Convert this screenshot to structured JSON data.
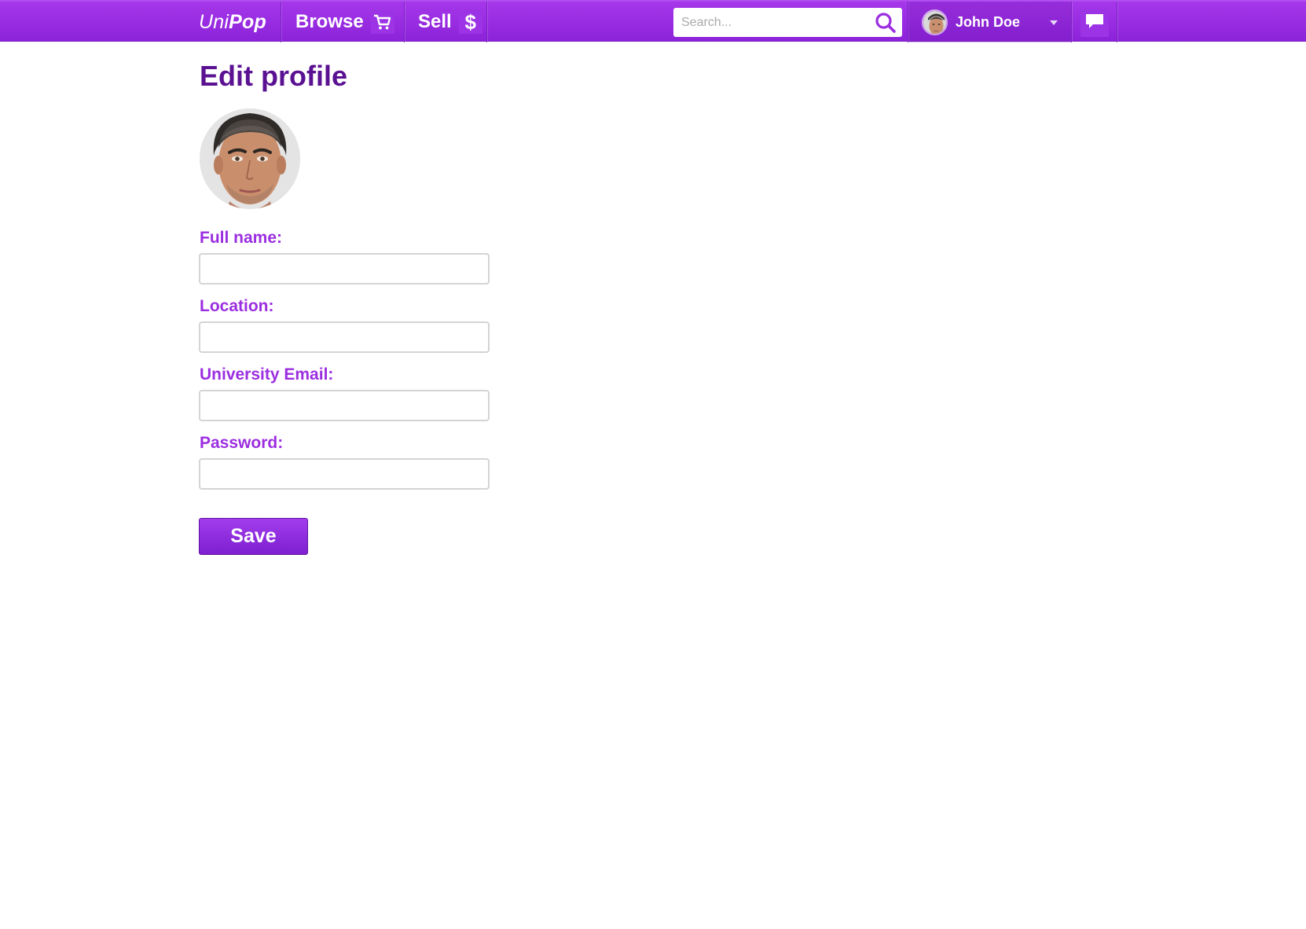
{
  "header": {
    "logo": {
      "part1": "Uni",
      "part2": "Pop"
    },
    "nav": {
      "browse_label": "Browse",
      "sell_label": "Sell",
      "sell_icon": "$"
    },
    "search": {
      "placeholder": "Search..."
    },
    "user": {
      "name": "John Doe"
    }
  },
  "main": {
    "title": "Edit profile",
    "form": {
      "full_name_label": "Full name:",
      "full_name_value": "",
      "location_label": "Location:",
      "location_value": "",
      "email_label": "University Email:",
      "email_value": "",
      "password_label": "Password:",
      "password_value": ""
    },
    "save_label": "Save"
  },
  "colors": {
    "brand_purple": "#9b2ee0",
    "title_purple": "#5a1192",
    "nav_gradient_top": "#a637ea",
    "nav_gradient_bottom": "#8c23d9"
  },
  "icons": {
    "browse": "cart-icon",
    "sell": "dollar-icon",
    "search": "search-icon",
    "dropdown": "chevron-down-icon",
    "messages": "chat-bubble-icon"
  }
}
